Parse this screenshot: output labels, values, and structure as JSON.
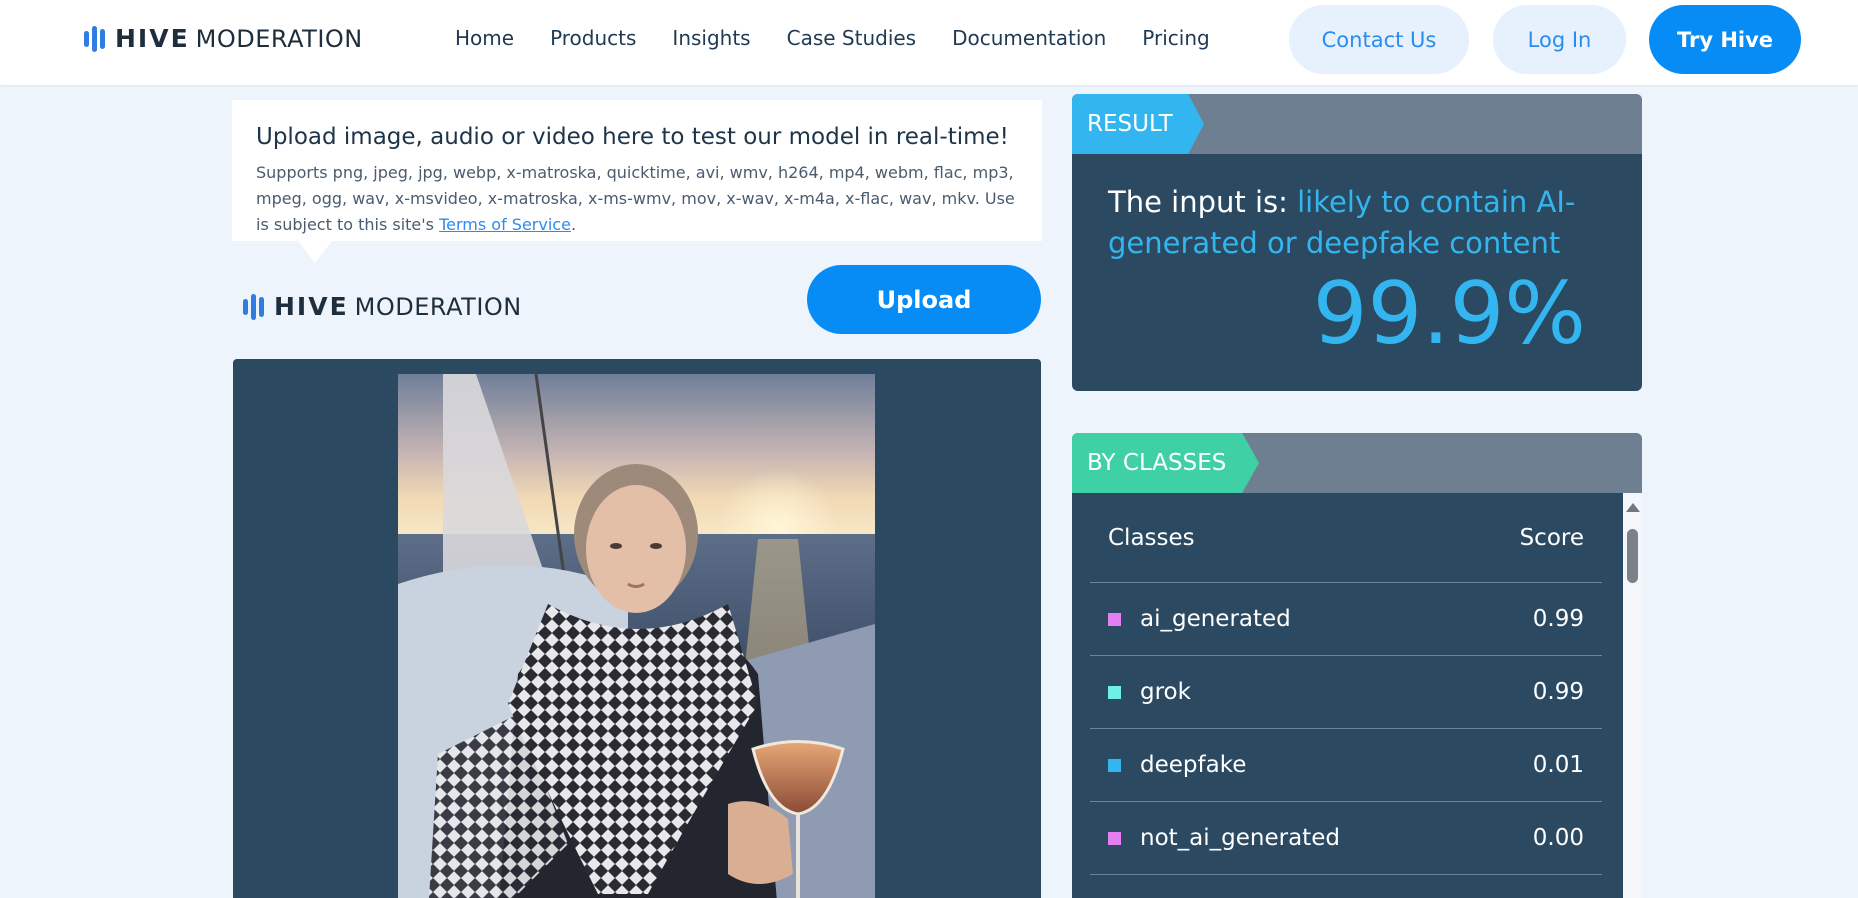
{
  "nav": {
    "logo": {
      "brand": "HIVE",
      "product": "MODERATION"
    },
    "links": [
      "Home",
      "Products",
      "Insights",
      "Case Studies",
      "Documentation",
      "Pricing"
    ],
    "contact_label": "Contact Us",
    "login_label": "Log In",
    "try_label": "Try Hive"
  },
  "upload_info": {
    "title": "Upload image, audio or video here to test our model in real-time!",
    "supports_text": "Supports png, jpeg, jpg, webp, x-matroska, quicktime, avi, wmv, h264, mp4, webm, flac, mp3, mpeg, ogg, wav, x-msvideo, x-matroska, x-ms-wmv, mov, x-wav, x-m4a, x-flac, wav, mkv. Use is subject to this site's ",
    "terms_link": "Terms of Service",
    "terms_suffix": "."
  },
  "upload": {
    "logo": {
      "brand": "HIVE",
      "product": "MODERATION"
    },
    "button_label": "Upload"
  },
  "result": {
    "tag": "RESULT",
    "prefix": "The input is: ",
    "verdict": "likely to contain AI-generated or deepfake content",
    "score": "99.9%"
  },
  "classes": {
    "tag": "BY CLASSES",
    "header_class": "Classes",
    "header_score": "Score",
    "rows": [
      {
        "name": "ai_generated",
        "score": "0.99",
        "color": "#e57ef0"
      },
      {
        "name": "grok",
        "score": "0.99",
        "color": "#6ff0e2"
      },
      {
        "name": "deepfake",
        "score": "0.01",
        "color": "#33b6ef"
      },
      {
        "name": "not_ai_generated",
        "score": "0.00",
        "color": "#e57ef0"
      }
    ]
  },
  "colors": {
    "accent_blue": "#078cf5",
    "result_cyan": "#33b6ef",
    "classes_green": "#3fd1a5",
    "panel_navy": "#2b4a62"
  }
}
